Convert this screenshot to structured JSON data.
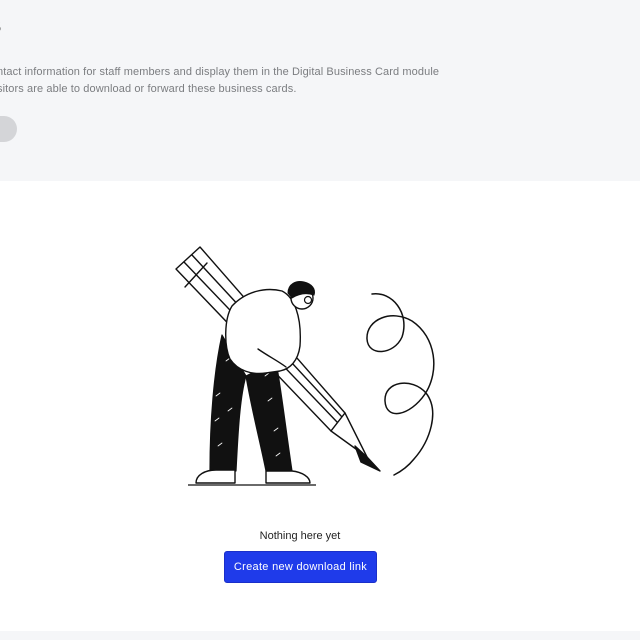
{
  "header": {
    "title": "s",
    "description_line1": "ntact information for staff members and display them in the Digital Business Card module",
    "description_line2": "sitors are able to download or forward these business cards."
  },
  "empty_state": {
    "illustration_icon": "person-drawing-with-pencil-icon",
    "message": "Nothing here yet",
    "button_label": "Create new download link"
  },
  "colors": {
    "header_background": "#f5f6f8",
    "primary_button": "#1f3bea",
    "description_text": "#7b7d80"
  }
}
